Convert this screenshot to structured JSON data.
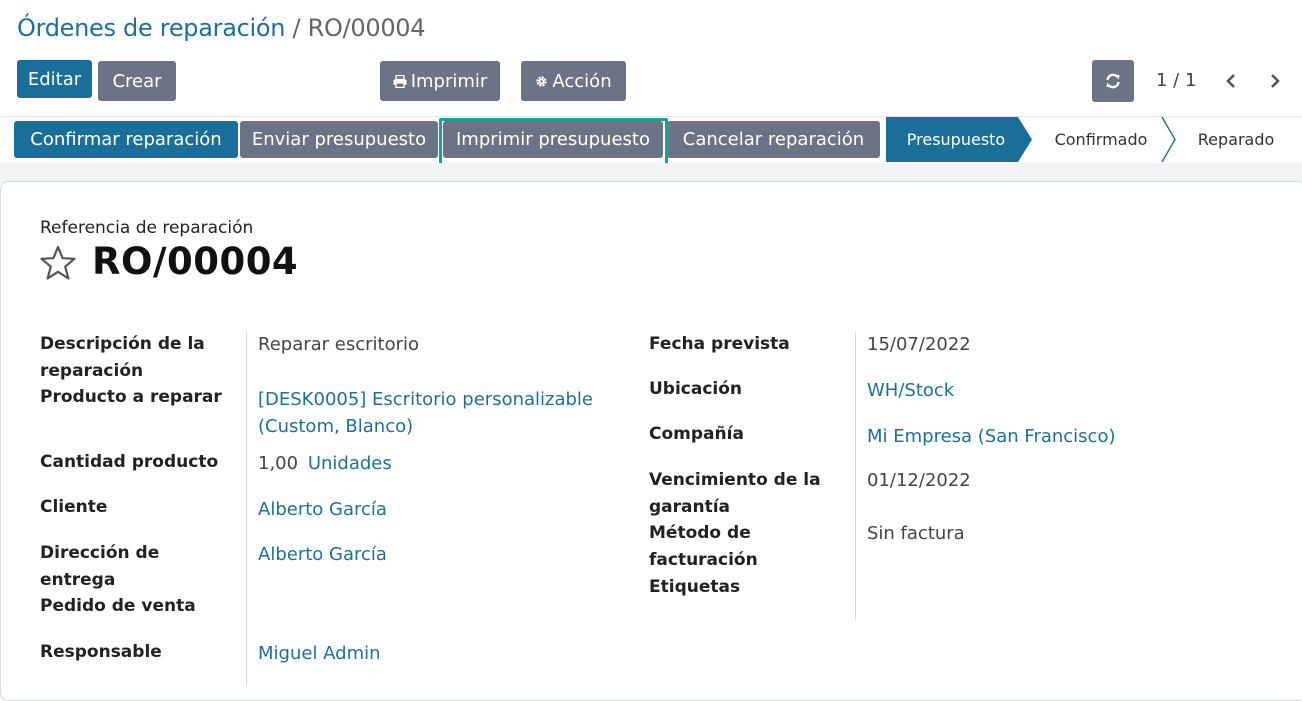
{
  "breadcrumb": {
    "parent": "Órdenes de reparación",
    "separator": "/",
    "current": "RO/00004"
  },
  "toolbar": {
    "edit": "Editar",
    "create": "Crear",
    "print": "Imprimir",
    "action": "Acción"
  },
  "pager": {
    "text": "1 / 1"
  },
  "statusbar": {
    "buttons": [
      "Confirmar reparación",
      "Enviar presupuesto",
      "Imprimir presupuesto",
      "Cancelar reparación"
    ],
    "stages": [
      "Presupuesto",
      "Confirmado",
      "Reparado"
    ],
    "active_stage": "Presupuesto"
  },
  "form": {
    "ref_label": "Referencia de reparación",
    "ref_name": "RO/00004",
    "left": {
      "descripcion_label_1": "Descripción de la",
      "descripcion_label_2": "reparación",
      "descripcion_value": "Reparar escritorio",
      "producto_label": "Producto a reparar",
      "producto_value_1": "[DESK0005] Escritorio personalizable",
      "producto_value_2": "(Custom, Blanco)",
      "cantidad_label": "Cantidad producto",
      "cantidad_value": "1,00",
      "cantidad_uom": "Unidades",
      "cliente_label": "Cliente",
      "cliente_value": "Alberto García",
      "direccion_label_1": "Dirección de",
      "direccion_label_2": "entrega",
      "direccion_value": "Alberto García",
      "pedido_label": "Pedido de venta",
      "responsable_label": "Responsable",
      "responsable_value": "Miguel Admin"
    },
    "right": {
      "fecha_label": "Fecha prevista",
      "fecha_value": "15/07/2022",
      "ubicacion_label": "Ubicación",
      "ubicacion_value": "WH/Stock",
      "compania_label": "Compañía",
      "compania_value": "Mi Empresa (San Francisco)",
      "garantia_label_1": "Vencimiento de la",
      "garantia_label_2": "garantía",
      "garantia_value": "01/12/2022",
      "metodo_label_1": "Método de",
      "metodo_label_2": "facturación",
      "metodo_value": "Sin factura",
      "etiquetas_label": "Etiquetas"
    }
  },
  "colors": {
    "primary": "#1a6f99",
    "secondary": "#6c7384",
    "link": "#1f6f9a",
    "highlight": "#14a39a"
  }
}
